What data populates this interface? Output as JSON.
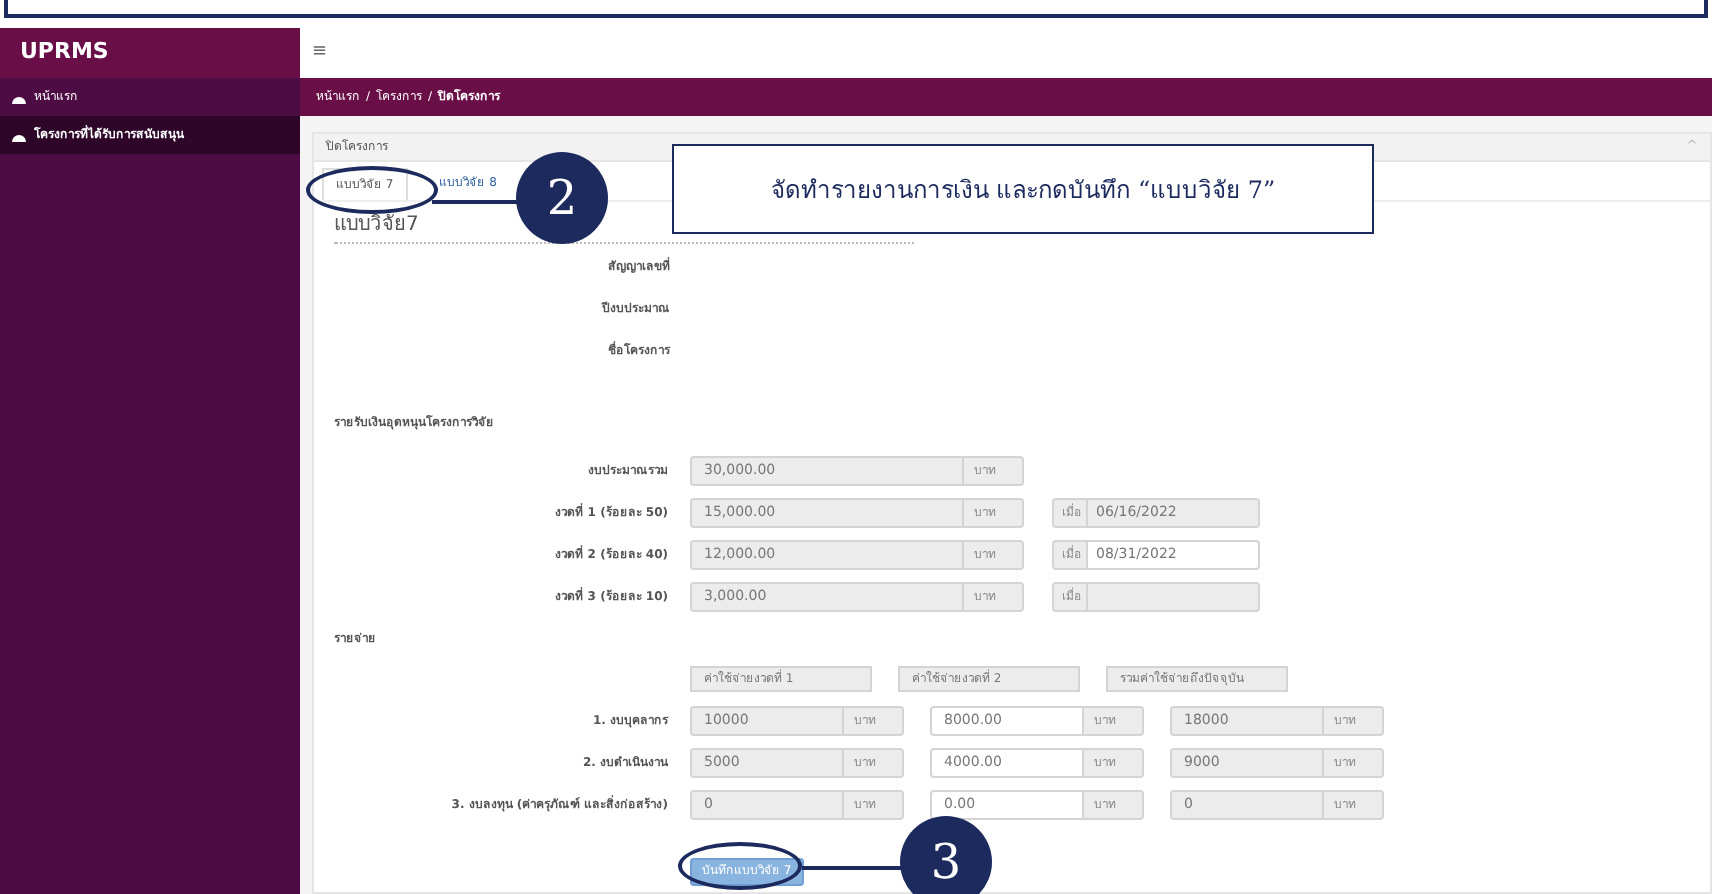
{
  "brand": "UPRMS",
  "sidebar": {
    "items": [
      {
        "label": "หน้าแรก",
        "selected": false
      },
      {
        "label": "โครงการที่ได้รับการสนับสนุน",
        "selected": true
      }
    ]
  },
  "topbar": {
    "menu": "≡"
  },
  "breadcrumb": {
    "separator": "/",
    "items": [
      "หน้าแรก",
      "โครงการ",
      "ปิดโครงการ"
    ]
  },
  "panel": {
    "title": "ปิดโครงการ",
    "collapse": "^",
    "tabs": [
      {
        "label": "แบบวิจัย 7",
        "selected": true
      },
      {
        "label": "แบบวิจัย 8",
        "selected": false
      }
    ],
    "heading": "แบบวิจัย7",
    "info_labels": [
      "สัญญาเลขที่",
      "ปีงบประมาณ",
      "ชื่อโครงการ"
    ],
    "income": {
      "title": "รายรับเงินอุดหนุนโครงการวิจัย",
      "rows": [
        {
          "label": "งบประมาณรวม",
          "value": "30,000.00",
          "unit": "บาท",
          "disabled": true
        },
        {
          "label": "งวดที่ 1 (ร้อยละ 50)",
          "value": "15,000.00",
          "unit": "บาท",
          "disabled": true,
          "date_label": "เมื่อ",
          "date": "06/16/2022",
          "date_disabled": true
        },
        {
          "label": "งวดที่ 2 (ร้อยละ 40)",
          "value": "12,000.00",
          "unit": "บาท",
          "disabled": true,
          "date_label": "เมื่อ",
          "date": "08/31/2022",
          "date_disabled": false
        },
        {
          "label": "งวดที่ 3 (ร้อยละ 10)",
          "value": "3,000.00",
          "unit": "บาท",
          "disabled": true,
          "date_label": "เมื่อ",
          "date_disabled": true
        }
      ]
    },
    "expense": {
      "title": "รายจ่าย",
      "columns": [
        "ค่าใช้จ่ายงวดที่ 1",
        "ค่าใช้จ่ายงวดที่ 2",
        "รวมค่าใช้จ่ายถึงปัจจุบัน"
      ],
      "rows": [
        {
          "label": "1. งบบุคลากร",
          "cells": [
            {
              "value": "10000",
              "unit": "บาท",
              "disabled": true
            },
            {
              "value": "8000.00",
              "unit": "บาท",
              "disabled": false
            },
            {
              "value": "18000",
              "unit": "บาท",
              "disabled": true
            }
          ]
        },
        {
          "label": "2. งบดำเนินงาน",
          "cells": [
            {
              "value": "5000",
              "unit": "บาท",
              "disabled": true
            },
            {
              "value": "4000.00",
              "unit": "บาท",
              "disabled": false
            },
            {
              "value": "9000",
              "unit": "บาท",
              "disabled": true
            }
          ]
        },
        {
          "label": "3. งบลงทุน (ค่าครุภัณฑ์ และสิ่งก่อสร้าง)",
          "cells": [
            {
              "value": "0",
              "unit": "บาท",
              "disabled": true
            },
            {
              "value": "0.00",
              "unit": "บาท",
              "disabled": false
            },
            {
              "value": "0",
              "unit": "บาท",
              "disabled": true
            }
          ]
        }
      ]
    },
    "save_button": "บันทึกแบบวิจัย 7"
  },
  "annotations": {
    "note": "จัดทำรายงานการเงิน และกดบันทึก “แบบวิจัย 7”",
    "step_a": "2",
    "step_b": "3"
  }
}
